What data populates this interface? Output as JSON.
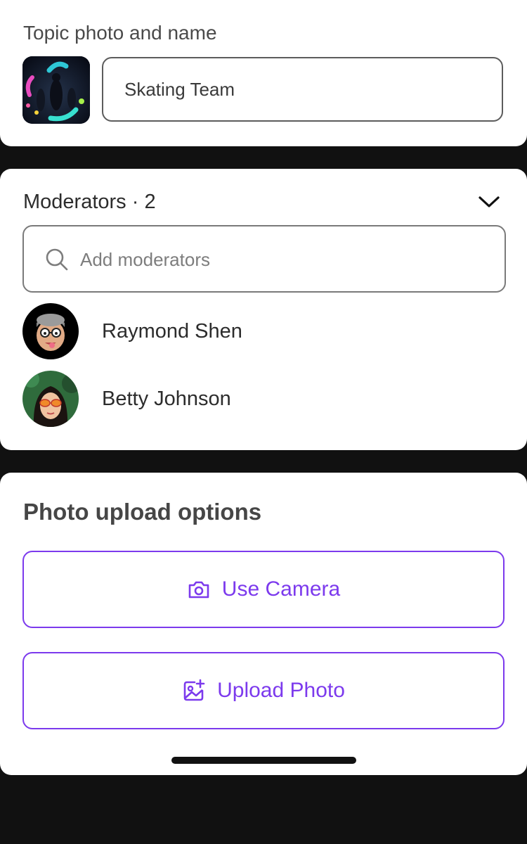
{
  "topic": {
    "label": "Topic photo and name",
    "name_value": "Skating Team",
    "photo_icon": "topic-photo"
  },
  "moderators": {
    "title": "Moderators · 2",
    "toggle_icon": "chevron-down-icon",
    "search": {
      "placeholder": "Add moderators",
      "icon": "search-icon"
    },
    "items": [
      {
        "name": "Raymond Shen",
        "avatar": "avatar-raymond"
      },
      {
        "name": "Betty Johnson",
        "avatar": "avatar-betty"
      }
    ]
  },
  "upload": {
    "title": "Photo upload options",
    "camera_label": "Use Camera",
    "camera_icon": "camera-icon",
    "photo_label": "Upload Photo",
    "photo_icon": "image-add-icon"
  },
  "colors": {
    "background": "#111111",
    "card": "#ffffff",
    "accent": "#7c3aed",
    "text_primary": "#2c2c2c",
    "text_secondary": "#4a4a4a"
  }
}
